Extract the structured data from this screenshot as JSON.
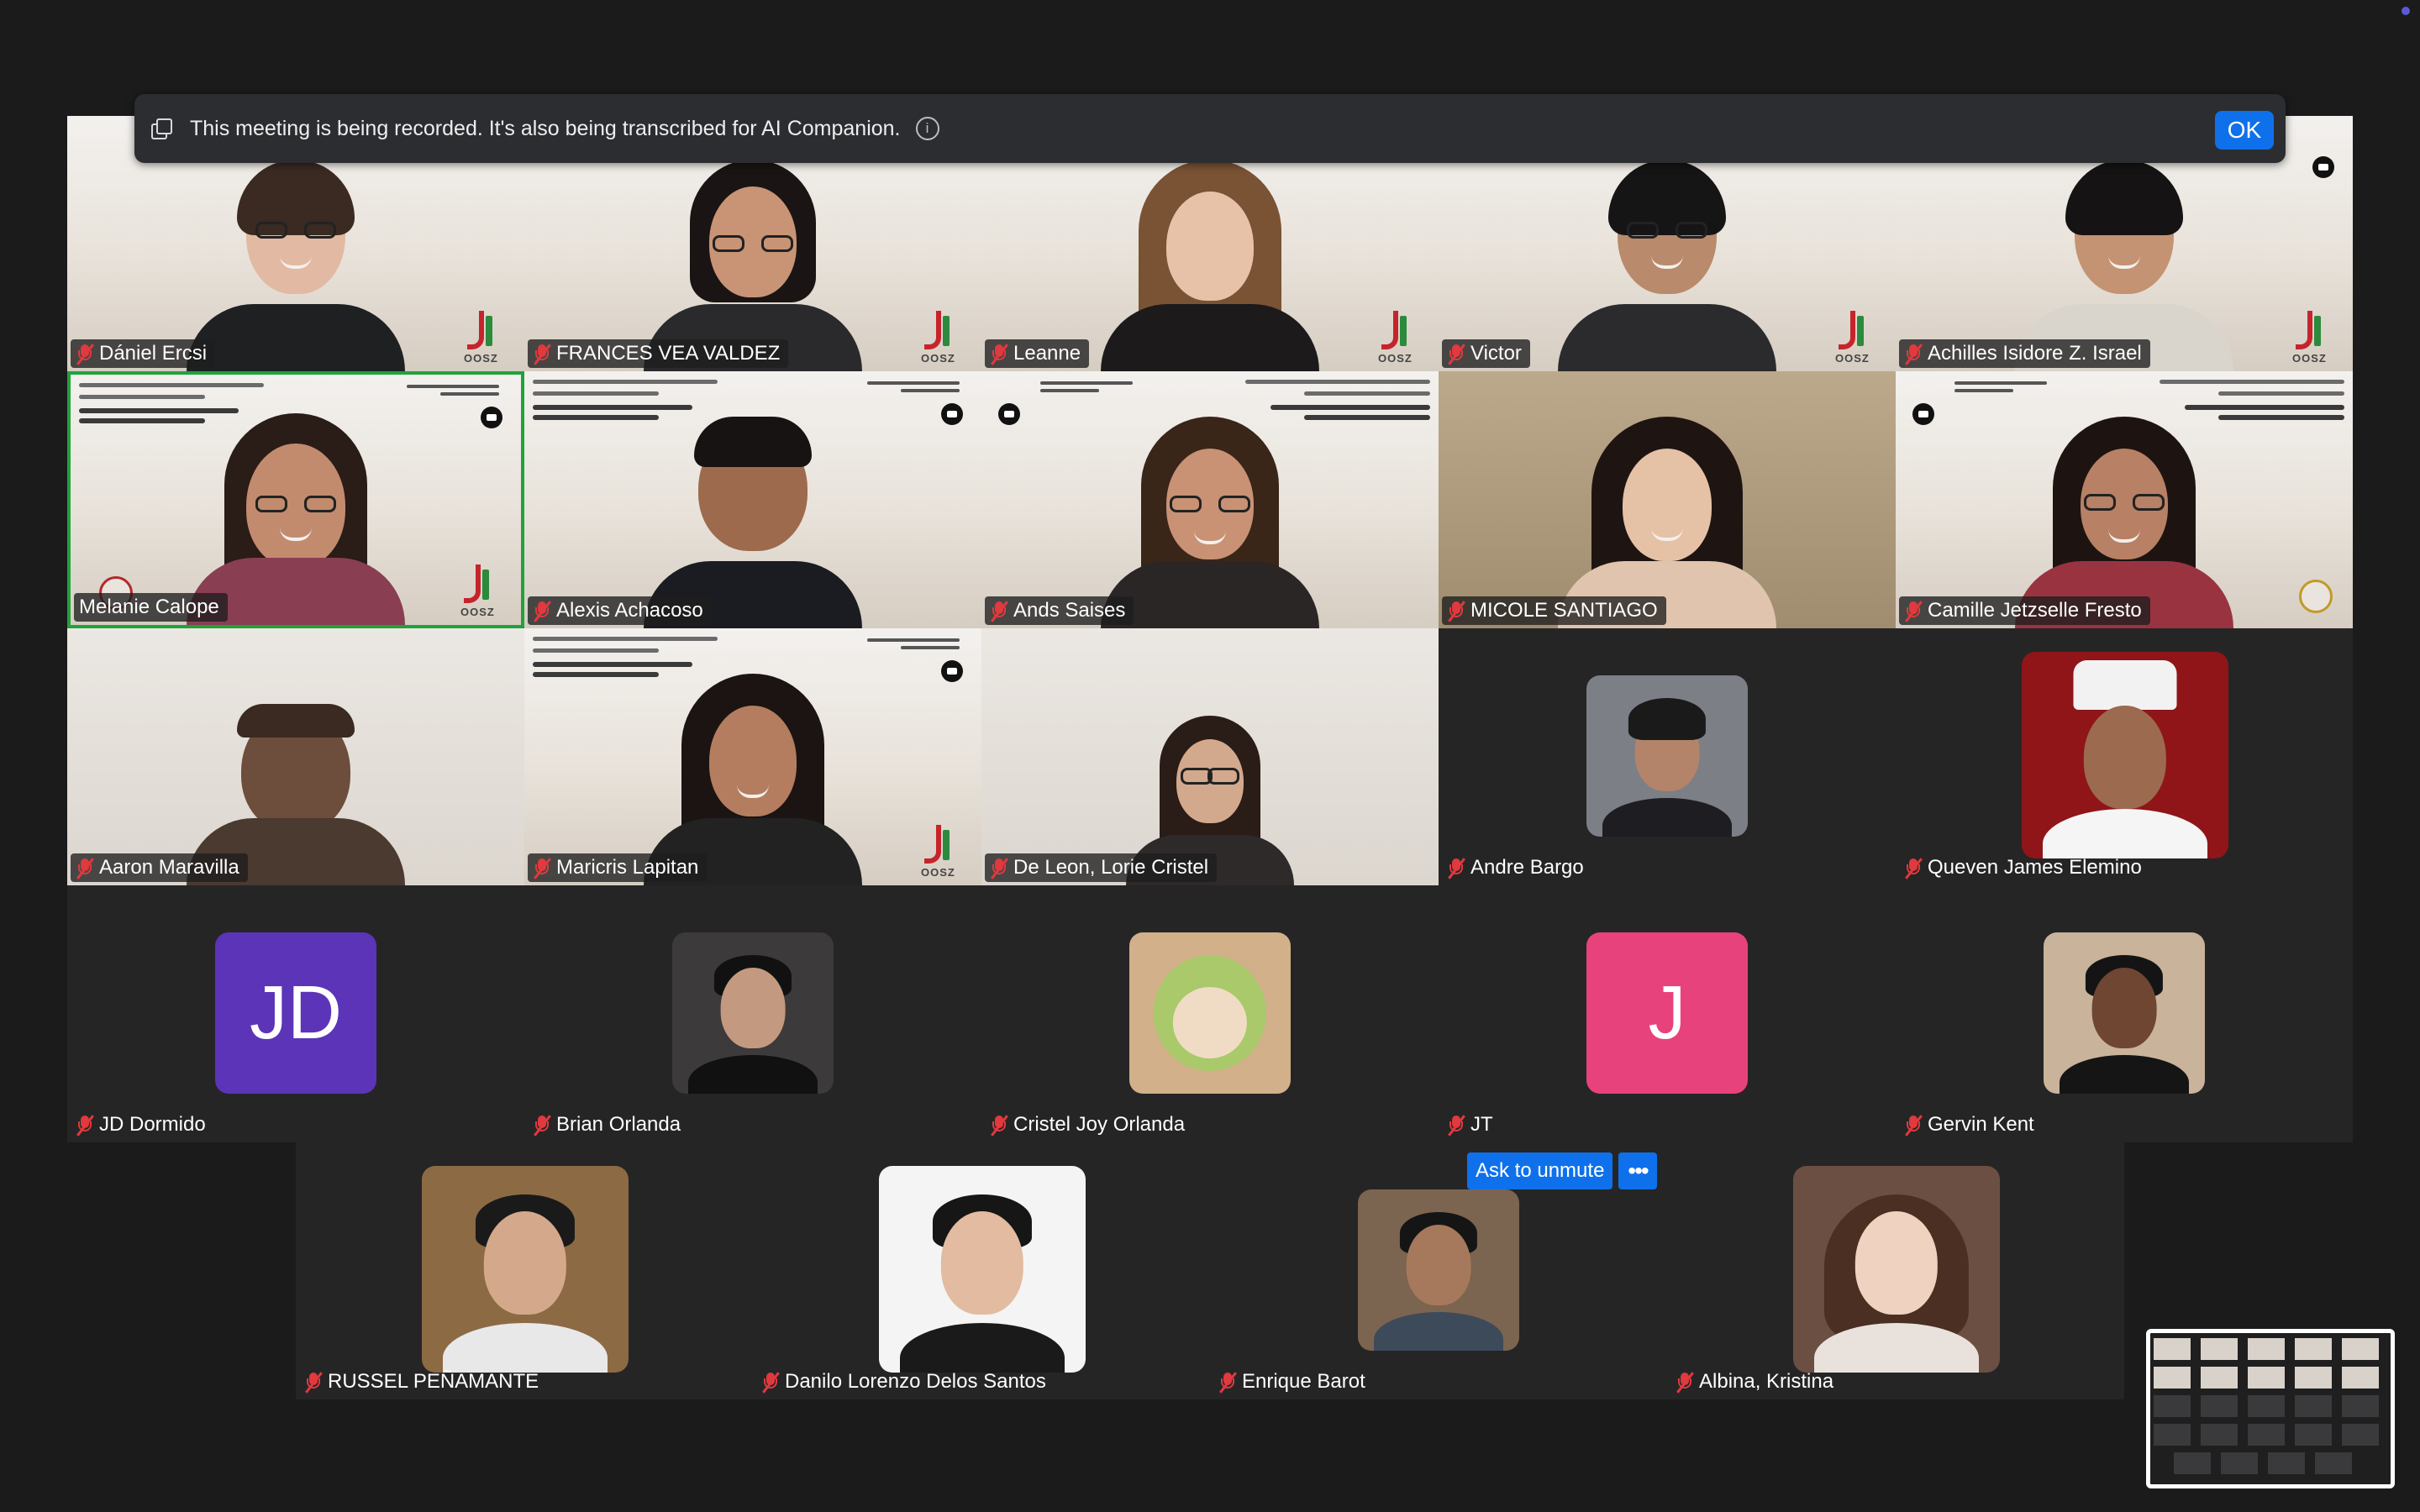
{
  "recording_banner": {
    "text": "This meeting is being recorded. It's also being transcribed for AI Companion.",
    "ok_label": "OK"
  },
  "participants": {
    "r1": [
      "Dániel Ercsi",
      "FRANCES VEA VALDEZ",
      "Leanne",
      "Victor",
      "Achilles Isidore Z. Israel"
    ],
    "r2": [
      "Melanie Calope",
      "Alexis Achacoso",
      "Ands Saises",
      "MICOLE SANTIAGO",
      "Camille Jetzselle Fresto"
    ],
    "r3": [
      "Aaron Maravilla",
      "Maricris Lapitan",
      "De Leon, Lorie Cristel",
      "Andre Bargo",
      "Queven James Elemino"
    ],
    "r4": [
      "JD Dormido",
      "Brian Orlanda",
      "Cristel Joy Orlanda",
      "JT",
      "Gervin Kent"
    ],
    "r5": [
      "RUSSEL PEÑAMANTE",
      "Danilo Lorenzo Delos Santos",
      "Enrique Barot",
      "Albina, Kristina"
    ]
  },
  "avatars": {
    "jd_initials": "JD",
    "jt_initials": "J",
    "jd_color": "#5b34b8",
    "jt_color": "#e8427c"
  },
  "hover_controls": {
    "ask_to_unmute": "Ask to unmute",
    "more": "•••"
  },
  "colors": {
    "active_speaker_border": "#1fa33a",
    "muted_icon": "#e0393e",
    "accent_button": "#0e71eb"
  },
  "icons": {
    "muted": "mic-off-icon",
    "camera": "video-camera-icon",
    "info": "info-icon",
    "record": "copy-icon"
  }
}
